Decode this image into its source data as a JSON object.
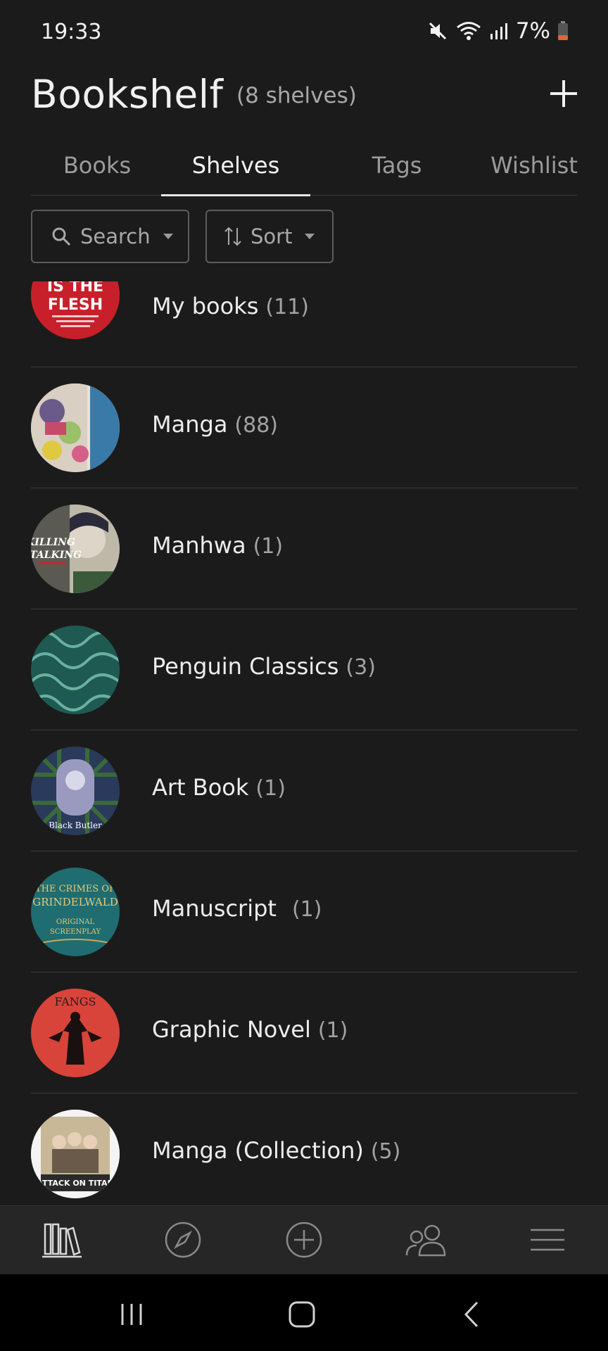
{
  "status_bar": {
    "time": "19:33",
    "battery": "7%",
    "icons": [
      "mute-icon",
      "wifi-icon",
      "signal-icon",
      "battery-low-icon"
    ]
  },
  "header": {
    "title": "Bookshelf",
    "subtitle": "(8 shelves)",
    "add_icon": "plus-icon"
  },
  "tabs": [
    {
      "label": "Books",
      "active": false
    },
    {
      "label": "Shelves",
      "active": true
    },
    {
      "label": "Tags",
      "active": false
    },
    {
      "label": "Wishlist",
      "active": false
    }
  ],
  "filters": {
    "search_label": "Search",
    "sort_label": "Sort"
  },
  "shelves": [
    {
      "name": "My books",
      "count": "(11)",
      "thumb_text": "IS THE FLESH",
      "thumb_color": "#c8202a"
    },
    {
      "name": "Manga",
      "count": "(88)",
      "thumb_color": "#7aa06a"
    },
    {
      "name": "Manhwa",
      "count": "(1)",
      "thumb_text": "KILLING STALKING",
      "thumb_color": "#3a3a3a"
    },
    {
      "name": "Penguin Classics",
      "count": "(3)",
      "thumb_color": "#1f5a52"
    },
    {
      "name": "Art Book",
      "count": "(1)",
      "thumb_text": "Black Butler",
      "thumb_color": "#2a3a5a"
    },
    {
      "name": "Manuscript",
      "count": "(1)",
      "thumb_text": "THE CRIMES OF GRINDELWALD",
      "thumb_color": "#1f6d70"
    },
    {
      "name": "Graphic Novel",
      "count": "(1)",
      "thumb_text": "FANGS",
      "thumb_color": "#d8443a"
    },
    {
      "name": "Manga (Collection)",
      "count": "(5)",
      "thumb_text": "ATTACK ON TITAN",
      "thumb_color": "#f2f2f2"
    }
  ],
  "bottom_nav": [
    "bookshelf-icon",
    "compass-icon",
    "add-circle-icon",
    "friends-icon",
    "menu-icon"
  ],
  "system_nav": [
    "recents-icon",
    "home-icon",
    "back-icon"
  ]
}
